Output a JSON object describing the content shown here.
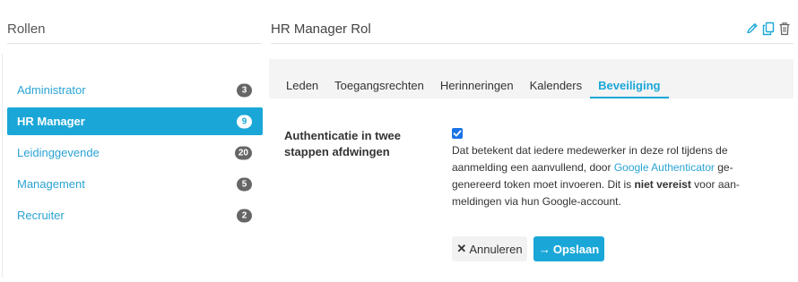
{
  "roles_panel": {
    "title": "Rollen",
    "items": [
      {
        "label": "Administrator",
        "count": "3"
      },
      {
        "label": "HR Manager",
        "count": "9"
      },
      {
        "label": "Leidinggevende",
        "count": "20"
      },
      {
        "label": "Management",
        "count": "5"
      },
      {
        "label": "Recruiter",
        "count": "2"
      }
    ]
  },
  "detail": {
    "title": "HR Manager Rol",
    "action_icons": [
      "pencil-icon",
      "copy-icon",
      "trash-icon"
    ],
    "tabs": [
      "Leden",
      "Toegangsrechten",
      "Herinneringen",
      "Kalenders",
      "Beveiliging"
    ],
    "active_tab": "Beveiliging",
    "setting": {
      "label": "Authenticatie in twee stappen afdwingen",
      "checked": true,
      "desc_part1": "Dat betekent dat iedere medewerker in deze rol tijdens de aanmelding een aanvullend, door ",
      "desc_link": "Google Authenticator",
      "desc_part2": " ge-genereerd token moet invoeren. Dit is ",
      "desc_bold": "niet vereist",
      "desc_part3": " voor aan-meldingen via hun Google-account."
    },
    "buttons": {
      "cancel_glyph": "✕",
      "cancel": "Annuleren",
      "save_glyph": "→",
      "save": "Opslaan"
    }
  },
  "colors": {
    "accent": "#1aa7d8",
    "badge": "#666666",
    "tabbar": "#f4f4f4",
    "checkbox": "#1a73e8"
  }
}
